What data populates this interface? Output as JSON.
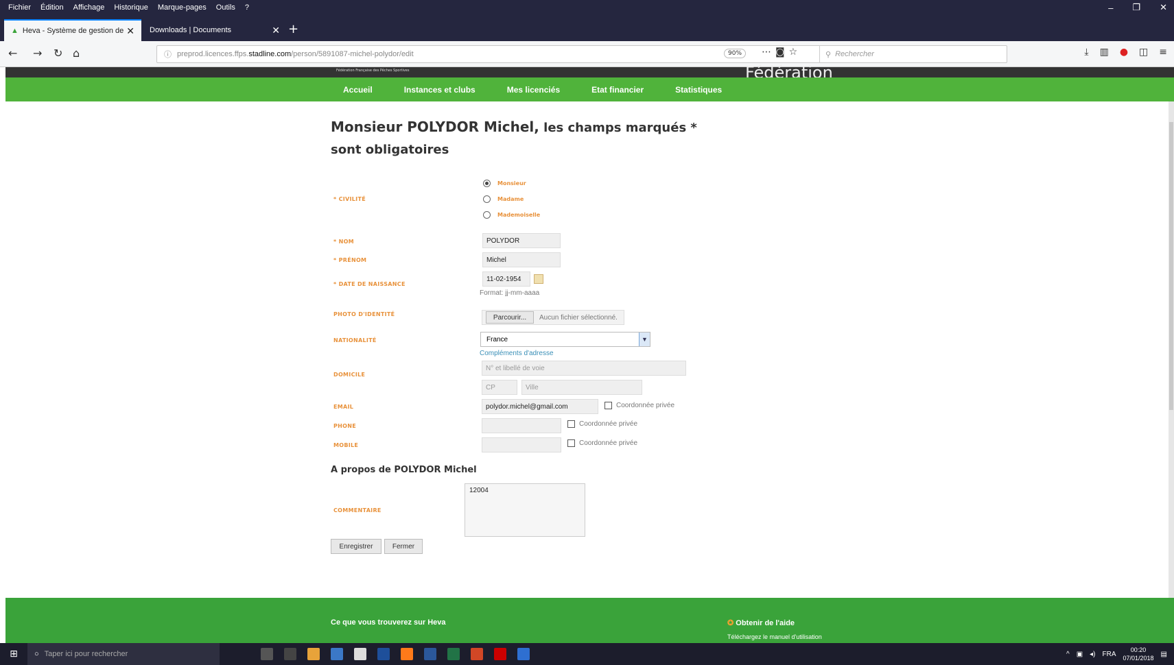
{
  "browser": {
    "menu": [
      "Fichier",
      "Édition",
      "Affichage",
      "Historique",
      "Marque-pages",
      "Outils",
      "?"
    ],
    "tabs": [
      {
        "label": "Heva - Système de gestion de"
      },
      {
        "label": "Downloads | Documents"
      }
    ],
    "url_prefix": "preprod.licences.ffps.",
    "url_host": "stadline.com",
    "url_path": "/person/5891087-michel-polydor/edit",
    "zoom": "90%",
    "search_placeholder": "Rechercher"
  },
  "site": {
    "federation_small": "Fédération Française des Pêches Sportives",
    "federation_large": "Fédération",
    "nav": [
      "Accueil",
      "Instances et clubs",
      "Mes licenciés",
      "Etat financier",
      "Statistiques"
    ]
  },
  "form": {
    "heading_name": "Monsieur POLYDOR Michel,",
    "heading_rest": " les champs marqués * sont obligatoires",
    "labels": {
      "civilite": "* CIVILITÉ",
      "nom": "* NOM",
      "prenom": "* PRÉNOM",
      "naissance": "* DATE DE NAISSANCE",
      "photo": "PHOTO D'IDENTITÉ",
      "nationalite": "NATIONALITÉ",
      "domicile": "DOMICILE",
      "email": "EMAIL",
      "phone": "PHONE",
      "mobile": "MOBILE",
      "commentaire": "COMMENTAIRE"
    },
    "civilite_options": [
      "Monsieur",
      "Madame",
      "Mademoiselle"
    ],
    "civilite_selected": "Monsieur",
    "nom": "POLYDOR",
    "prenom": "Michel",
    "date_naissance": "11-02-1954",
    "date_format_hint": "Format: jj-mm-aaaa",
    "file_button": "Parcourir...",
    "file_status": "Aucun fichier sélectionné.",
    "nationalite": "France",
    "complement_link": "Compléments d'adresse",
    "address_placeholder": "N° et libellé de voie",
    "cp_placeholder": "CP",
    "ville_placeholder": "Ville",
    "email": "polydor.michel@gmail.com",
    "private_label": "Coordonnée privée",
    "about_title": "A propos de POLYDOR Michel",
    "commentaire": "12004",
    "save_button": "Enregistrer",
    "close_button": "Fermer"
  },
  "footer": {
    "left_title": "Ce que vous trouverez sur Heva",
    "right_title": "Obtenir de l'aide",
    "right_sub": "Téléchargez le manuel d'utilisation"
  },
  "taskbar": {
    "search_placeholder": "Taper ici pour rechercher",
    "lang": "FRA",
    "time": "00:20",
    "date": "07/01/2018"
  }
}
